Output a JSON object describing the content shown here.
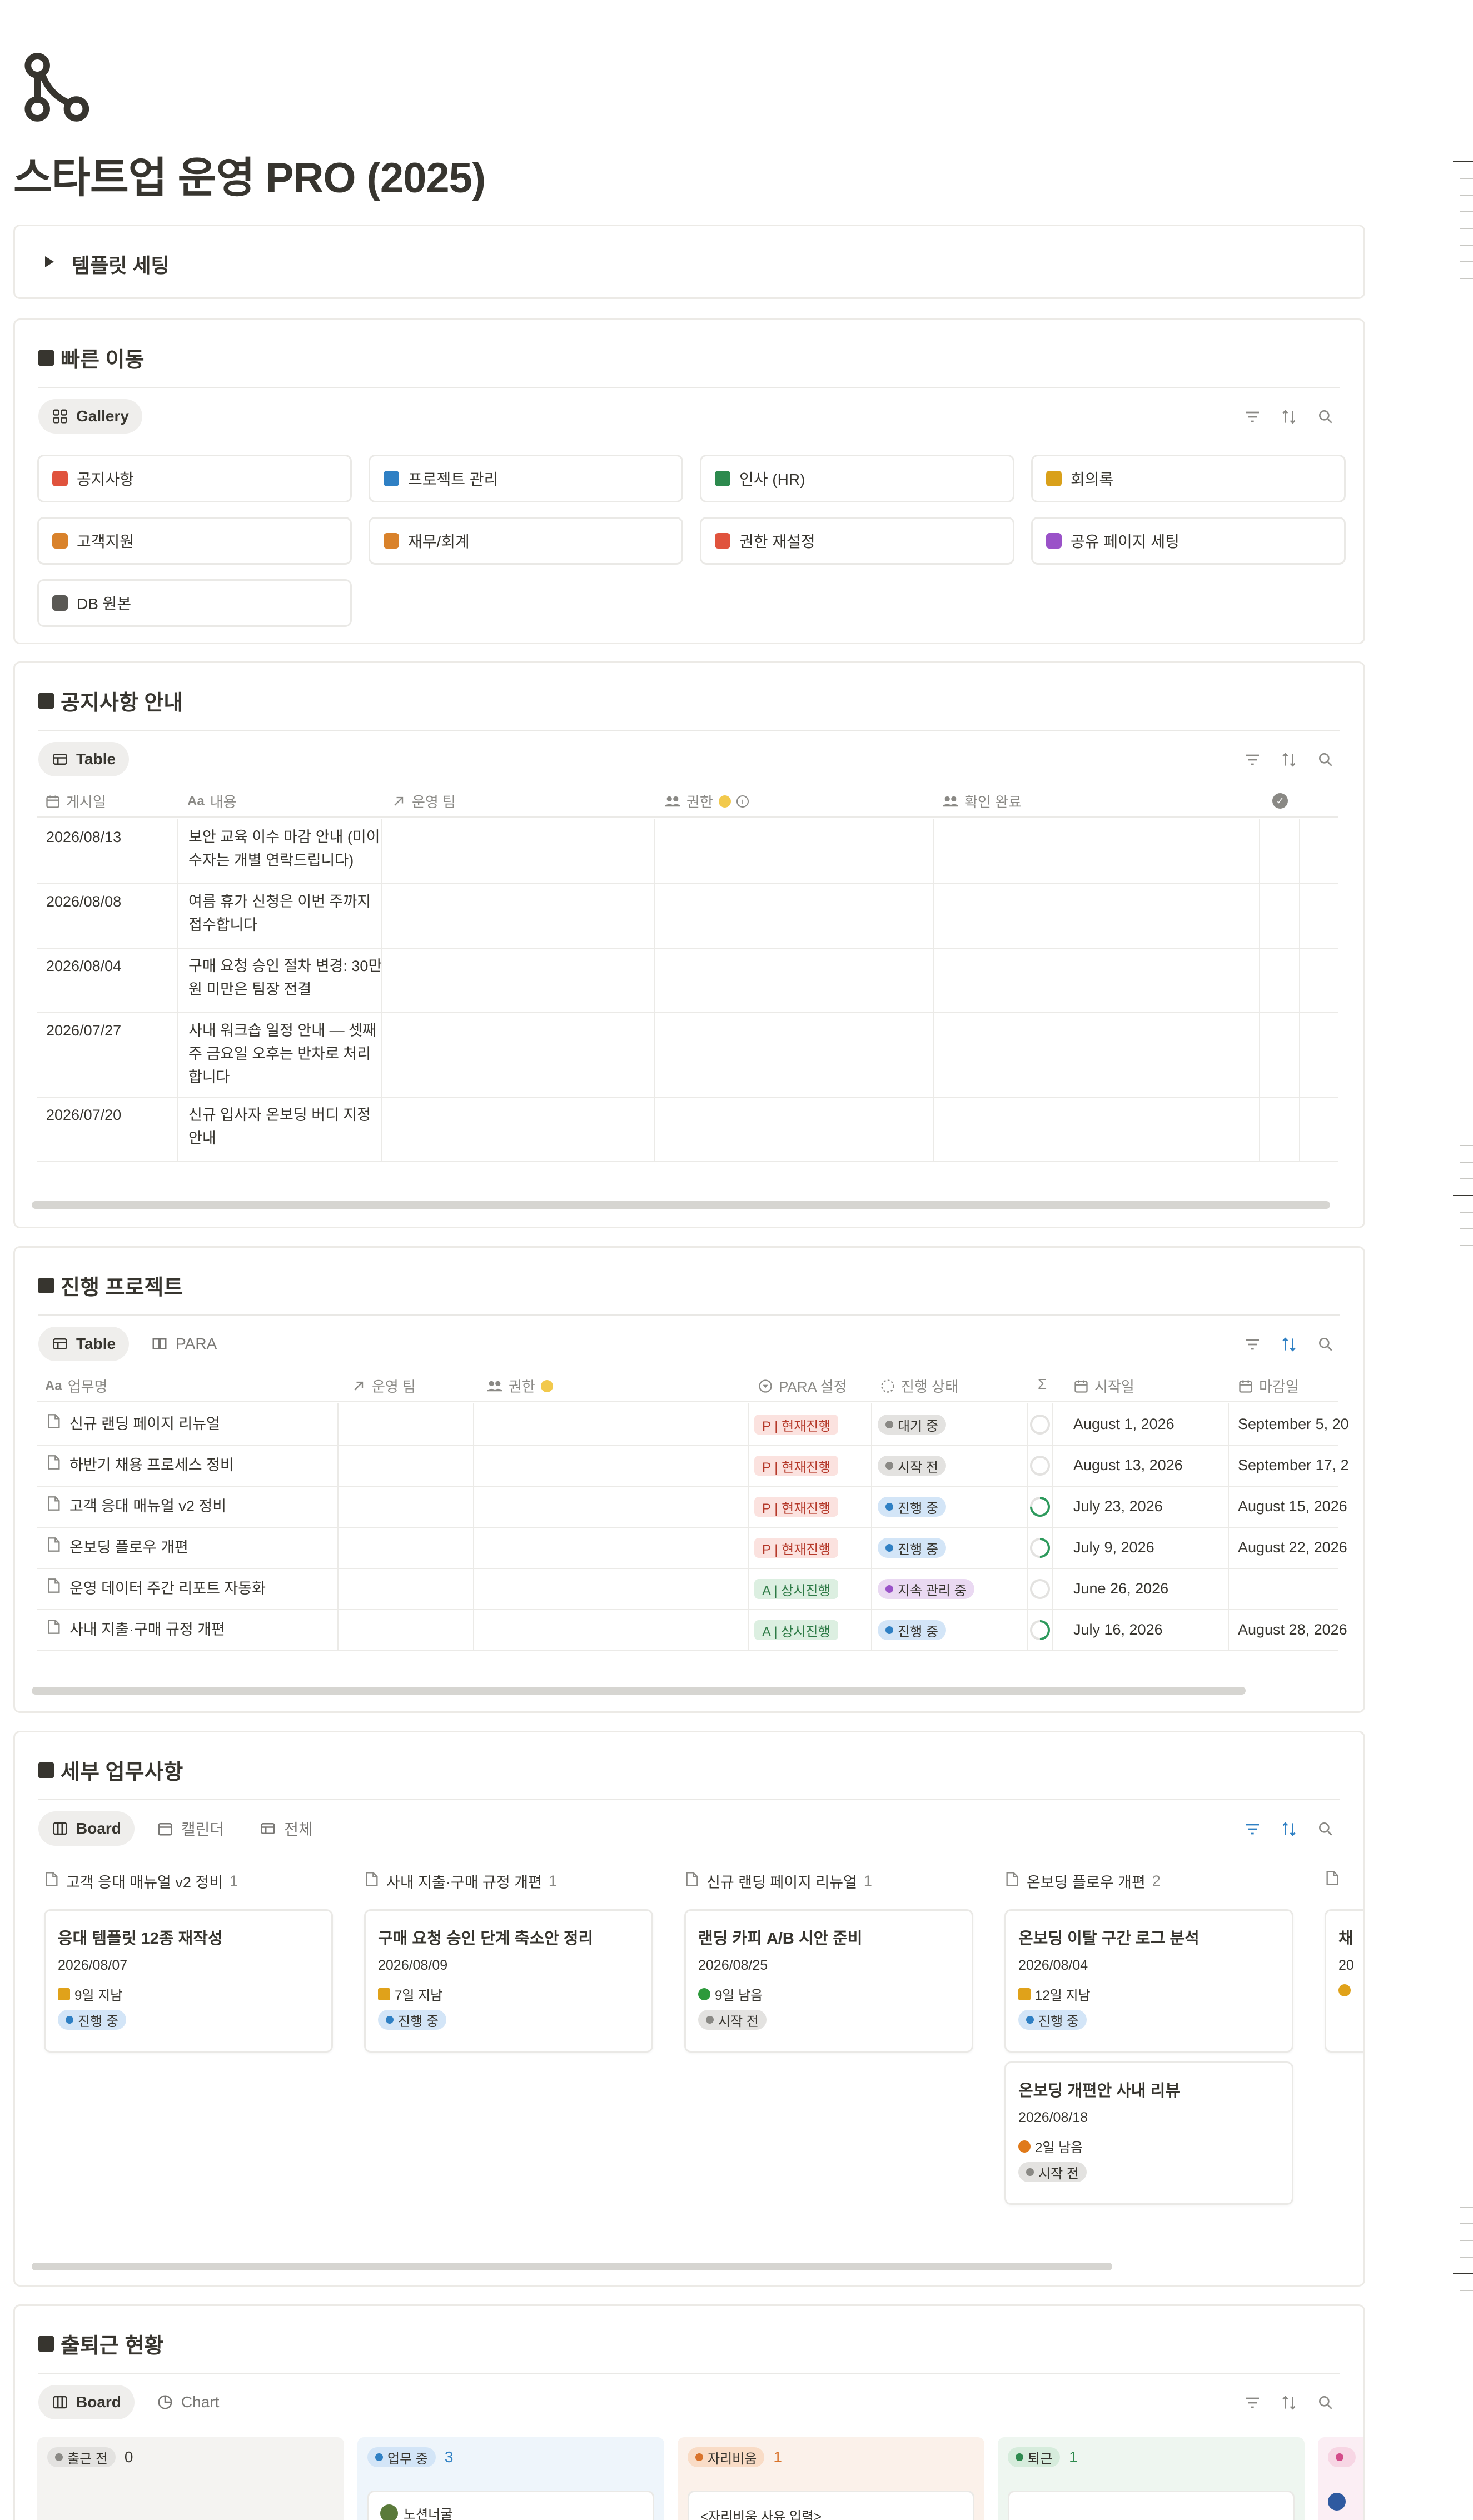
{
  "page": {
    "title": "스타트업 운영 PRO (2025)",
    "icon": "share-network-icon",
    "toggle_label": "템플릿 세팅"
  },
  "quick": {
    "title": "빠른 이동",
    "view_label": "Gallery",
    "items": [
      {
        "label": "공지사항",
        "icon": "megaphone-icon",
        "color": "#e0533d"
      },
      {
        "label": "프로젝트 관리",
        "icon": "target-icon",
        "color": "#2f80c4"
      },
      {
        "label": "인사 (HR)",
        "icon": "person-icon",
        "color": "#2d8a4e"
      },
      {
        "label": "회의록",
        "icon": "sticky-note-icon",
        "color": "#d9a01a"
      },
      {
        "label": "고객지원",
        "icon": "chat-bubbles-icon",
        "color": "#d9822b"
      },
      {
        "label": "재무/회계",
        "icon": "money-icon",
        "color": "#d9822b"
      },
      {
        "label": "권한 재설정",
        "icon": "refresh-icon",
        "color": "#e0533d"
      },
      {
        "label": "공유 페이지 세팅",
        "icon": "share-network-icon",
        "color": "#9a52c8"
      },
      {
        "label": "DB 원본",
        "icon": "folder-icon",
        "color": "#5a5955"
      }
    ]
  },
  "notice": {
    "title": "공지사항 안내",
    "view_label": "Table",
    "columns": [
      "게시일",
      "내용",
      "운영 팀",
      "권한",
      "확인 완료"
    ],
    "rows": [
      {
        "date": "2026/08/13",
        "content": "보안 교육 이수 마감 안내 (미이수자는 개별 연락드립니다)"
      },
      {
        "date": "2026/08/08",
        "content": "여름 휴가 신청은 이번 주까지 접수합니다"
      },
      {
        "date": "2026/08/04",
        "content": "구매 요청 승인 절차 변경: 30만원 미만은 팀장 전결"
      },
      {
        "date": "2026/07/27",
        "content": "사내 워크숍 일정 안내 — 셋째 주 금요일 오후는 반차로 처리합니다"
      },
      {
        "date": "2026/07/20",
        "content": "신규 입사자 온보딩 버디 지정 안내"
      }
    ]
  },
  "projects": {
    "title": "진행 프로젝트",
    "views": [
      "Table",
      "PARA"
    ],
    "columns": [
      "업무명",
      "운영 팀",
      "권한",
      "PARA 설정",
      "진행 상태",
      "Σ",
      "시작일",
      "마감일"
    ],
    "rows": [
      {
        "name": "신규 랜딩 페이지 리뉴얼",
        "para": "P | 현재진행",
        "status": "대기 중",
        "progress": 0,
        "start": "August 1, 2026",
        "end": "September 5, 20"
      },
      {
        "name": "하반기 채용 프로세스 정비",
        "para": "P | 현재진행",
        "status": "시작 전",
        "progress": 0,
        "start": "August 13, 2026",
        "end": "September 17, 2"
      },
      {
        "name": "고객 응대 매뉴얼 v2 정비",
        "para": "P | 현재진행",
        "status": "진행 중",
        "progress": 0.75,
        "start": "July 23, 2026",
        "end": "August 15, 2026"
      },
      {
        "name": "온보딩 플로우 개편",
        "para": "P | 현재진행",
        "status": "진행 중",
        "progress": 0.5,
        "start": "July 9, 2026",
        "end": "August 22, 2026"
      },
      {
        "name": "운영 데이터 주간 리포트 자동화",
        "para": "A | 상시진행",
        "status": "지속 관리 중",
        "progress": 0,
        "start": "June 26, 2026",
        "end": ""
      },
      {
        "name": "사내 지출·구매 규정 개편",
        "para": "A | 상시진행",
        "status": "진행 중",
        "progress": 0.5,
        "start": "July 16, 2026",
        "end": "August 28, 2026"
      }
    ],
    "status_colors": {
      "대기 중": {
        "bg": "#e3e2e0",
        "dot": "#8a8985"
      },
      "시작 전": {
        "bg": "#e3e2e0",
        "dot": "#8a8985"
      },
      "진행 중": {
        "bg": "#d3e5f7",
        "dot": "#2f80c4"
      },
      "지속 관리 중": {
        "bg": "#ead9f2",
        "dot": "#9a52c8"
      }
    }
  },
  "tasks": {
    "title": "세부 업무사항",
    "views": [
      "Board",
      "캘린더",
      "전체"
    ],
    "columns": [
      {
        "name": "고객 응대 매뉴얼 v2 정비",
        "count": "1",
        "cards": [
          {
            "title": "응대 템플릿 12종 재작성",
            "date": "2026/08/07",
            "remain": "9일 지남",
            "remain_icon": "warning-icon",
            "status": "진행 중"
          }
        ]
      },
      {
        "name": "사내 지출·구매 규정 개편",
        "count": "1",
        "cards": [
          {
            "title": "구매 요청 승인 단계 축소안 정리",
            "date": "2026/08/09",
            "remain": "7일 지남",
            "remain_icon": "warning-icon",
            "status": "진행 중"
          }
        ]
      },
      {
        "name": "신규 랜딩 페이지 리뉴얼",
        "count": "1",
        "cards": [
          {
            "title": "랜딩 카피 A/B 시안 준비",
            "date": "2026/08/25",
            "remain": "9일 남음",
            "remain_icon": "green-circle-icon",
            "status": "시작 전"
          }
        ]
      },
      {
        "name": "온보딩 플로우 개편",
        "count": "2",
        "cards": [
          {
            "title": "온보딩 이탈 구간 로그 분석",
            "date": "2026/08/04",
            "remain": "12일 지남",
            "remain_icon": "warning-icon",
            "status": "진행 중"
          },
          {
            "title": "온보딩 개편안 사내 리뷰",
            "date": "2026/08/18",
            "remain": "2일 남음",
            "remain_icon": "orange-circle-icon",
            "status": "시작 전"
          }
        ]
      },
      {
        "name": "",
        "count": "",
        "cards": [
          {
            "title": "채",
            "date": "20",
            "remain": "",
            "remain_icon": "bell-icon",
            "status": ""
          }
        ]
      }
    ]
  },
  "attendance": {
    "title": "출퇴근 현황",
    "views": [
      "Board",
      "Chart"
    ],
    "groups": [
      {
        "label": "출근 전",
        "count": "0",
        "bg": "#f4f3f1",
        "pill_bg": "#e3e2e0",
        "dot": "#8a8985",
        "count_color": "#37352f"
      },
      {
        "label": "업무 중",
        "count": "3",
        "bg": "#eef5fb",
        "pill_bg": "#d3e5f7",
        "dot": "#2f80c4",
        "count_color": "#2f80c4"
      },
      {
        "label": "자리비움",
        "count": "1",
        "bg": "#fbf1ea",
        "pill_bg": "#f9dcc6",
        "dot": "#d9732b",
        "count_color": "#d9732b"
      },
      {
        "label": "퇴근",
        "count": "1",
        "bg": "#eef6f0",
        "pill_bg": "#d6ecdc",
        "dot": "#2d8a4e",
        "count_color": "#2d8a4e"
      },
      {
        "label": "",
        "count": "",
        "bg": "#fbeef4",
        "pill_bg": "#f7d6e4",
        "dot": "#d44b8a",
        "count_color": "#d44b8a"
      }
    ],
    "card_person": "노션너굴",
    "card_away": "<자리비움 사유 입력>"
  }
}
